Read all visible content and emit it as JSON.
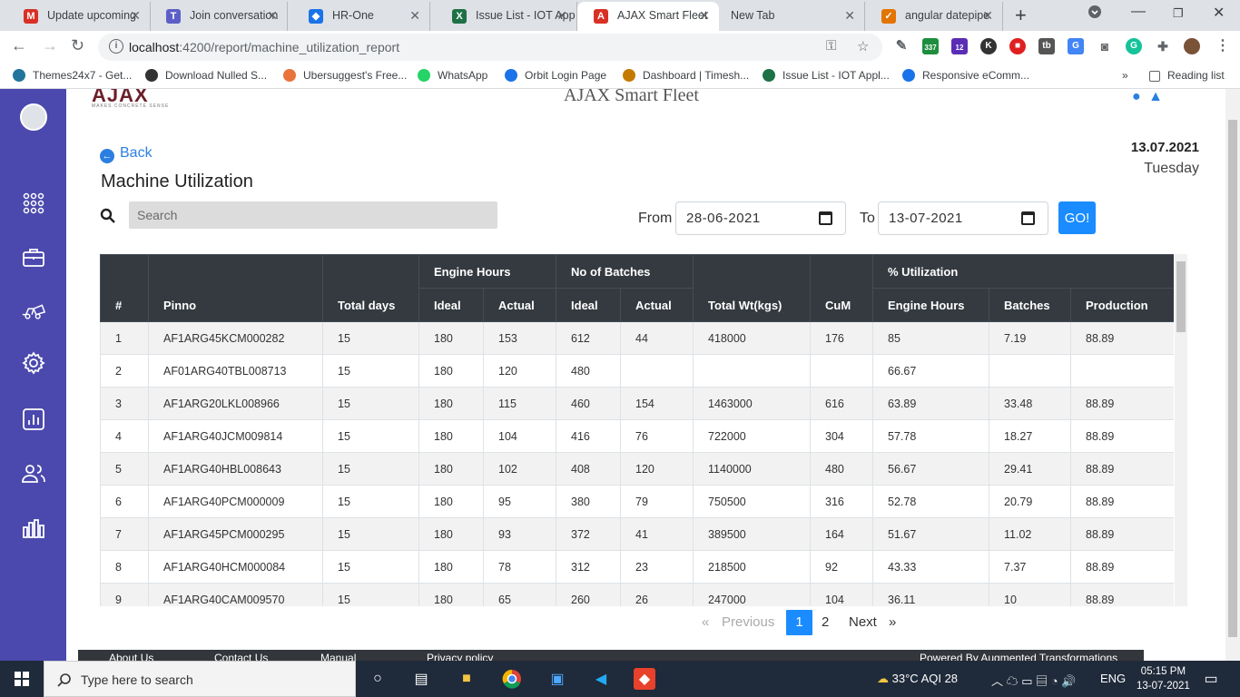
{
  "browser": {
    "tabs": [
      {
        "title": "Update upcoming",
        "favicon": "gmail-icon",
        "color": "#d93025"
      },
      {
        "title": "Join conversation",
        "favicon": "teams-icon",
        "color": "#5b5fc7"
      },
      {
        "title": "HR-One",
        "favicon": "hrone-icon",
        "color": "#1a73e8"
      },
      {
        "title": "Issue List - IOT App",
        "favicon": "excel-icon",
        "color": "#1e7145"
      },
      {
        "title": "AJAX Smart Fleet",
        "favicon": "ajax-icon",
        "color": "#d93025"
      },
      {
        "title": "New Tab",
        "favicon": "",
        "color": "#5f6368"
      },
      {
        "title": "angular datepipe",
        "favicon": "search-icon",
        "color": "#e37400"
      }
    ],
    "url_host": "localhost",
    "url_rest": ":4200/report/machine_utilization_report",
    "bookmarks": [
      {
        "label": "Themes24x7 - Get...",
        "color": "#21759b"
      },
      {
        "label": "Download Nulled S...",
        "color": "#333"
      },
      {
        "label": "Ubersuggest's Free...",
        "color": "#e8743b"
      },
      {
        "label": "WhatsApp",
        "color": "#25d366"
      },
      {
        "label": "Orbit Login Page",
        "color": "#1a73e8"
      },
      {
        "label": "Dashboard | Timesh...",
        "color": "#c47a00"
      },
      {
        "label": "Issue List - IOT Appl...",
        "color": "#1e7145"
      },
      {
        "label": "Responsive eComm...",
        "color": "#1a73e8"
      }
    ],
    "more_bookmarks": "»",
    "reading_list": "Reading list",
    "ext_badges": {
      "green": "337",
      "purple": "12"
    }
  },
  "app": {
    "logo": "AJAX",
    "logo_sub": "MAKES CONCRETE SENSE",
    "title": "AJAX Smart Fleet",
    "back": "Back",
    "page_title": "Machine Utilization",
    "date": "13.07.2021",
    "weekday": "Tuesday",
    "search_placeholder": "Search",
    "from_label": "From",
    "to_label": "To",
    "from_date": "28-06-2021",
    "to_date": "13-07-2021",
    "go": "GO!"
  },
  "table": {
    "group_headers": {
      "engine_hours": "Engine Hours",
      "batches": "No of Batches",
      "utilization": "% Utilization"
    },
    "columns": [
      "#",
      "Pinno",
      "Total days",
      "Ideal",
      "Actual",
      "Ideal",
      "Actual",
      "Total Wt(kgs)",
      "CuM",
      "Engine Hours",
      "Batches",
      "Production"
    ],
    "rows": [
      [
        "1",
        "AF1ARG45KCM000282",
        "15",
        "180",
        "153",
        "612",
        "44",
        "418000",
        "176",
        "85",
        "7.19",
        "88.89"
      ],
      [
        "2",
        "AF01ARG40TBL008713",
        "15",
        "180",
        "120",
        "480",
        "",
        "",
        "",
        "66.67",
        "",
        ""
      ],
      [
        "3",
        "AF1ARG20LKL008966",
        "15",
        "180",
        "115",
        "460",
        "154",
        "1463000",
        "616",
        "63.89",
        "33.48",
        "88.89"
      ],
      [
        "4",
        "AF1ARG40JCM009814",
        "15",
        "180",
        "104",
        "416",
        "76",
        "722000",
        "304",
        "57.78",
        "18.27",
        "88.89"
      ],
      [
        "5",
        "AF1ARG40HBL008643",
        "15",
        "180",
        "102",
        "408",
        "120",
        "1140000",
        "480",
        "56.67",
        "29.41",
        "88.89"
      ],
      [
        "6",
        "AF1ARG40PCM000009",
        "15",
        "180",
        "95",
        "380",
        "79",
        "750500",
        "316",
        "52.78",
        "20.79",
        "88.89"
      ],
      [
        "7",
        "AF1ARG45PCM000295",
        "15",
        "180",
        "93",
        "372",
        "41",
        "389500",
        "164",
        "51.67",
        "11.02",
        "88.89"
      ],
      [
        "8",
        "AF1ARG40HCM000084",
        "15",
        "180",
        "78",
        "312",
        "23",
        "218500",
        "92",
        "43.33",
        "7.37",
        "88.89"
      ],
      [
        "9",
        "AF1ARG40CAM009570",
        "15",
        "180",
        "65",
        "260",
        "26",
        "247000",
        "104",
        "36.11",
        "10",
        "88.89"
      ]
    ]
  },
  "pagination": {
    "prev_arrow": "«",
    "previous": "Previous",
    "pages": [
      "1",
      "2"
    ],
    "next": "Next",
    "next_arrow": "»"
  },
  "footer": {
    "about": "About Us",
    "contact": "Contact Us",
    "manual": "Manual",
    "privacy": "Privacy policy",
    "powered": "Powered By Augmented Transformations"
  },
  "taskbar": {
    "search": "Type here to search",
    "weather": "33°C  AQI 28",
    "lang": "ENG",
    "time": "05:15 PM",
    "date": "13-07-2021"
  }
}
